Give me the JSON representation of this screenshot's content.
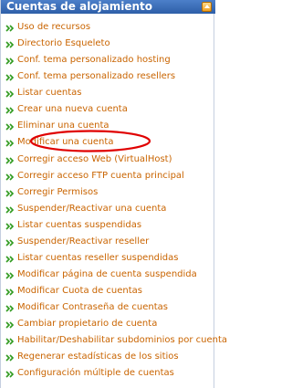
{
  "header": {
    "title": "Cuentas de alojamiento"
  },
  "items": [
    {
      "label": "Uso de recursos"
    },
    {
      "label": "Directorio Esqueleto"
    },
    {
      "label": "Conf. tema personalizado hosting"
    },
    {
      "label": "Conf. tema personalizado resellers"
    },
    {
      "label": "Listar cuentas"
    },
    {
      "label": "Crear una nueva cuenta"
    },
    {
      "label": "Eliminar una cuenta"
    },
    {
      "label": "Modificar una cuenta"
    },
    {
      "label": "Corregir acceso Web (VirtualHost)"
    },
    {
      "label": "Corregir acceso FTP cuenta principal"
    },
    {
      "label": "Corregir Permisos"
    },
    {
      "label": "Suspender/Reactivar una cuenta"
    },
    {
      "label": "Listar cuentas suspendidas"
    },
    {
      "label": "Suspender/Reactivar reseller"
    },
    {
      "label": "Listar cuentas reseller suspendidas"
    },
    {
      "label": "Modificar página de cuenta suspendida"
    },
    {
      "label": "Modificar Cuota de cuentas"
    },
    {
      "label": "Modificar Contraseña de cuentas"
    },
    {
      "label": "Cambiar propietario de cuenta"
    },
    {
      "label": "Habilitar/Deshabilitar subdominios por cuenta"
    },
    {
      "label": "Regenerar estadísticas de los sitios"
    },
    {
      "label": "Configuración múltiple de cuentas"
    }
  ],
  "colors": {
    "link": "#c96400",
    "bullet": "#2f9a1e",
    "header": "#3a6bb5",
    "annotation": "#e00000"
  },
  "icons": {
    "bullet": "double-chevron-right-icon",
    "collapse": "collapse-up-icon"
  }
}
